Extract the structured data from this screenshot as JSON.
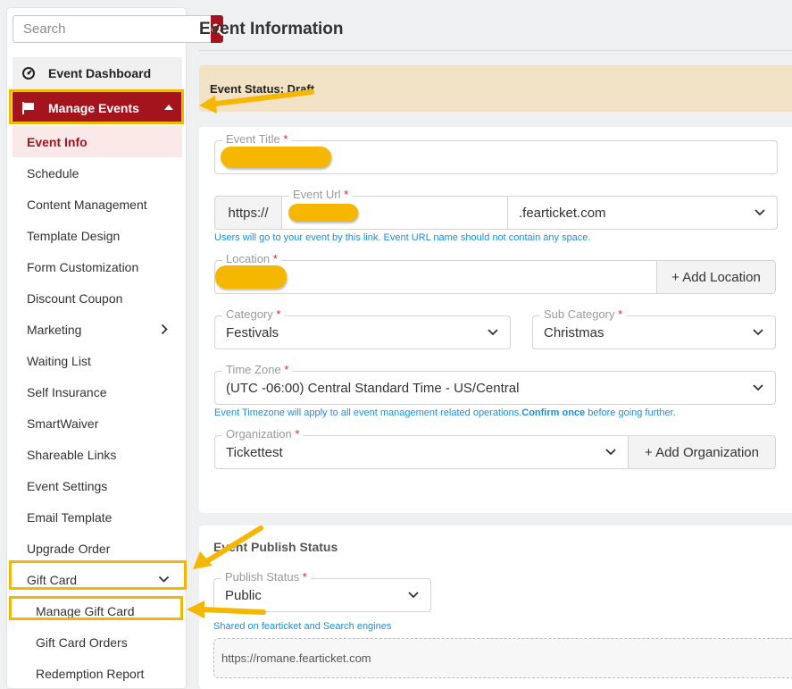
{
  "sidebar": {
    "search_placeholder": "Search",
    "dashboard_label": "Event Dashboard",
    "manage_events_label": "Manage Events",
    "items": [
      {
        "label": "Event Info"
      },
      {
        "label": "Schedule"
      },
      {
        "label": "Content Management"
      },
      {
        "label": "Template Design"
      },
      {
        "label": "Form Customization"
      },
      {
        "label": "Discount Coupon"
      },
      {
        "label": "Marketing"
      },
      {
        "label": "Waiting List"
      },
      {
        "label": "Self Insurance"
      },
      {
        "label": "SmartWaiver"
      },
      {
        "label": "Shareable Links"
      },
      {
        "label": "Event Settings"
      },
      {
        "label": "Email Template"
      },
      {
        "label": "Upgrade Order"
      },
      {
        "label": "Gift Card"
      },
      {
        "label": "Manage Gift Card"
      },
      {
        "label": "Gift Card Orders"
      },
      {
        "label": "Redemption Report"
      }
    ]
  },
  "main": {
    "title": "Event Information",
    "status": "Event Status: Draft",
    "form": {
      "event_title_label": "Event Title",
      "event_url_label": "Event Url",
      "url_prefix": "https://",
      "domain": ".fearticket.com",
      "url_help": "Users will go to your event by this link. Event URL name should not contain any space.",
      "location_label": "Location",
      "add_location": "+ Add Location",
      "category_label": "Category",
      "category_value": "Festivals",
      "subcategory_label": "Sub Category",
      "subcategory_value": "Christmas",
      "timezone_label": "Time Zone",
      "timezone_value": "(UTC -06:00) Central Standard Time - US/Central",
      "tz_help_pre": "Event Timezone will apply to all event management related operations.",
      "tz_help_bold": "Confirm once",
      "tz_help_post": " before going further.",
      "org_label": "Organization",
      "org_value": "Tickettest",
      "add_org": "+ Add Organization",
      "required_mark": "*"
    },
    "publish": {
      "title": "Event Publish Status",
      "status_label": "Publish Status",
      "status_value": "Public",
      "help": "Shared on fearticket and Search engines",
      "url": "https://romane.fearticket.com"
    }
  },
  "colors": {
    "brand": "#a3141c",
    "highlight": "#f2b705",
    "link": "#1a8fd8",
    "status_bg": "#f3e3c6"
  },
  "icons": [
    "search-icon",
    "dashboard-icon",
    "flag-icon",
    "caret-up-icon",
    "chevron-right-icon",
    "chevron-down-icon"
  ]
}
